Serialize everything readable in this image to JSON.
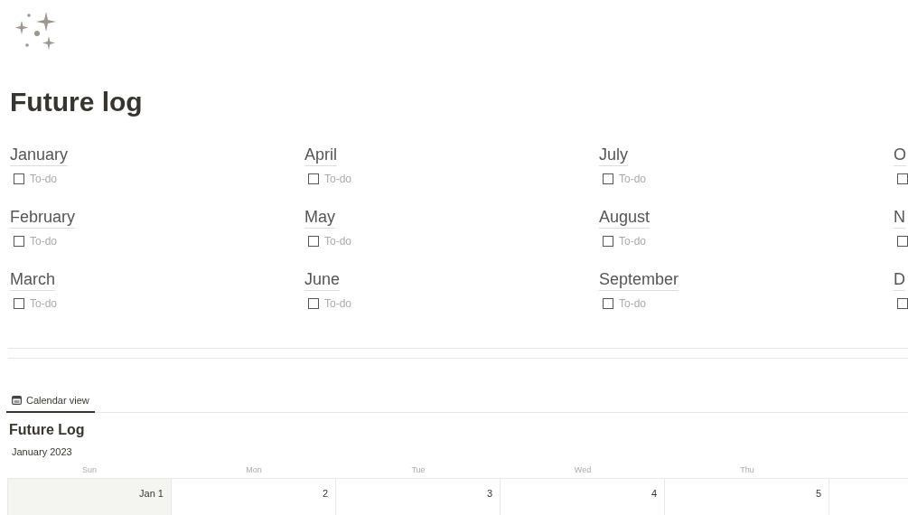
{
  "title": "Future log",
  "months": [
    {
      "name": "January",
      "todo": {
        "label": "To-do",
        "checked": false
      }
    },
    {
      "name": "February",
      "todo": {
        "label": "To-do",
        "checked": false
      }
    },
    {
      "name": "March",
      "todo": {
        "label": "To-do",
        "checked": false
      }
    },
    {
      "name": "April",
      "todo": {
        "label": "To-do",
        "checked": false
      }
    },
    {
      "name": "May",
      "todo": {
        "label": "To-do",
        "checked": false
      }
    },
    {
      "name": "June",
      "todo": {
        "label": "To-do",
        "checked": false
      }
    },
    {
      "name": "July",
      "todo": {
        "label": "To-do",
        "checked": false
      }
    },
    {
      "name": "August",
      "todo": {
        "label": "To-do",
        "checked": false
      }
    },
    {
      "name": "September",
      "todo": {
        "label": "To-do",
        "checked": false
      }
    },
    {
      "name": "O",
      "todo": {
        "checked": false
      }
    },
    {
      "name": "N",
      "todo": {
        "checked": false
      }
    },
    {
      "name": "D",
      "todo": {
        "checked": false
      }
    }
  ],
  "view_tabs": [
    {
      "label": "Calendar view",
      "selected": true
    }
  ],
  "database_title": "Future Log",
  "calendar": {
    "month": "January 2023",
    "weekdays": [
      "Sun",
      "Mon",
      "Tue",
      "Wed",
      "Thu"
    ],
    "days": [
      {
        "label": "Jan 1",
        "weekend": true
      },
      {
        "label": "2",
        "weekend": false
      },
      {
        "label": "3",
        "weekend": false
      },
      {
        "label": "4",
        "weekend": false
      },
      {
        "label": "5",
        "weekend": false
      }
    ]
  }
}
